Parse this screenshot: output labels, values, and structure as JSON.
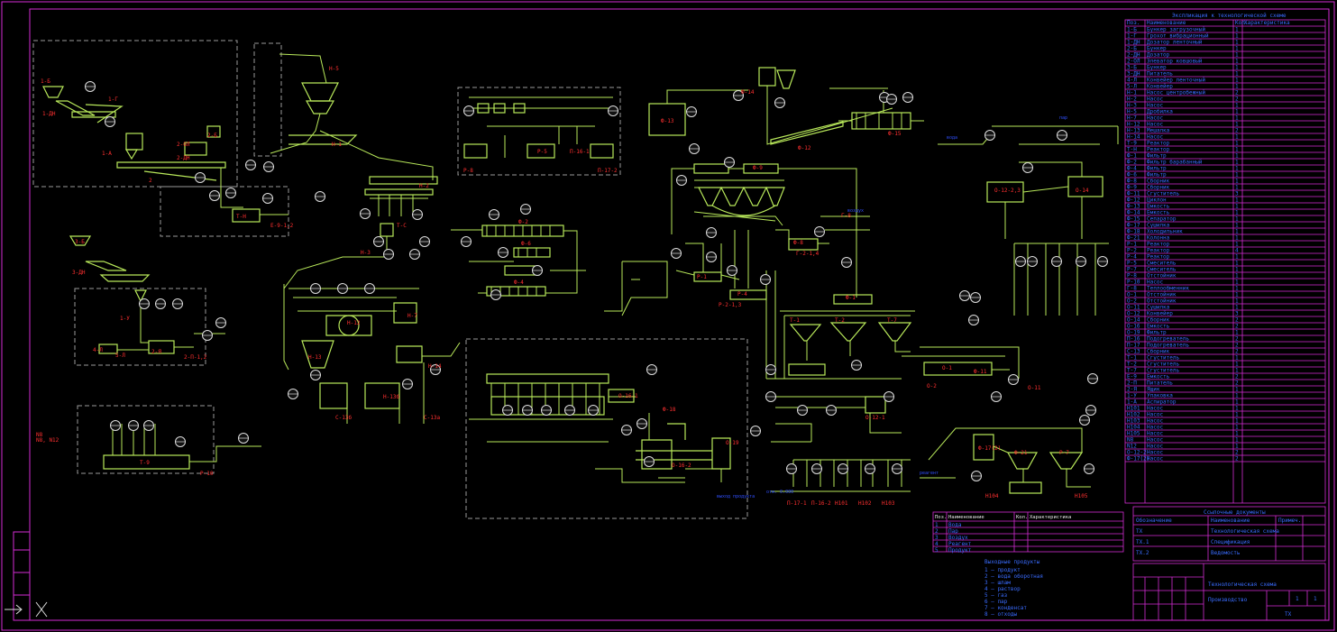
{
  "drawing": {
    "equipment_labels": [
      "1-Б",
      "1-ДН",
      "1-Г",
      "1-А",
      "2",
      "2-ДН",
      "2-ОЛ",
      "2-Б",
      "3-Б",
      "3-ДН",
      "1-У",
      "4-Л",
      "5-Л",
      "2-Я",
      "2-П-1,2",
      "Н-5",
      "Н-1",
      "Н-2",
      "Н-3",
      "Н-7",
      "Н-12",
      "Н-13",
      "Н-13б",
      "Н-14",
      "Т-Н",
      "Е-9-1,2",
      "Т-С",
      "С-13а",
      "С-13б",
      "Т-9",
      "Р-10",
      "Ф-2",
      "Ф-6",
      "Ф-4",
      "Ф-13",
      "Ф-14",
      "Ф-15",
      "Ф-12",
      "Ф-8",
      "Ф-9",
      "Ф-11",
      "Р-4",
      "Р-1",
      "Р-2-1,3",
      "Ф-1",
      "Г-8",
      "Г-2-1,4",
      "Т-1",
      "Т-2",
      "Т-7",
      "О-1",
      "О-2",
      "О-11",
      "О-12-1",
      "О-12-2,3",
      "О-14",
      "О-16-1",
      "О-16-2",
      "Ф-18",
      "О-19",
      "Ф-17(2)",
      "Ф-21",
      "Р-7",
      "Р-8",
      "Р-5",
      "П-16-1",
      "П-17-2",
      "П-17-1",
      "П-16-2",
      "Н101",
      "Н102",
      "Н103",
      "Н104",
      "Н105",
      "N8",
      "N8, N12"
    ],
    "flow_labels": [
      "отм. 0.000",
      "вода",
      "пар",
      "воздух",
      "реагент",
      "выход продукта"
    ],
    "spec_table": {
      "title": "Экспликация к технологической схеме",
      "headers": [
        "Поз.",
        "Наименование",
        "Кол.",
        "Характеристика"
      ],
      "rows": [
        [
          "1-Б",
          "Бункер загрузочный",
          "1",
          ""
        ],
        [
          "1-Г",
          "Грохот вибрационный",
          "1",
          ""
        ],
        [
          "1-ДН",
          "Дозатор ленточный",
          "1",
          ""
        ],
        [
          "2-Б",
          "Бункер",
          "1",
          ""
        ],
        [
          "2-ДН",
          "Дозатор",
          "1",
          ""
        ],
        [
          "2-ОЛ",
          "Элеватор ковшовый",
          "1",
          ""
        ],
        [
          "3-Б",
          "Бункер",
          "1",
          ""
        ],
        [
          "3-ДН",
          "Питатель",
          "1",
          ""
        ],
        [
          "4-Л",
          "Конвейер ленточный",
          "1",
          ""
        ],
        [
          "5-Л",
          "Конвейер",
          "1",
          ""
        ],
        [
          "Н-1",
          "Насос центробежный",
          "2",
          ""
        ],
        [
          "Н-2",
          "Насос",
          "2",
          ""
        ],
        [
          "Н-3",
          "Насос",
          "1",
          ""
        ],
        [
          "Н-5",
          "Дробилка",
          "1",
          ""
        ],
        [
          "Н-7",
          "Насос",
          "1",
          ""
        ],
        [
          "Н-12",
          "Насос",
          "1",
          ""
        ],
        [
          "Н-13",
          "Мешалка",
          "2",
          ""
        ],
        [
          "Н-14",
          "Насос",
          "1",
          ""
        ],
        [
          "Т-9",
          "Реактор",
          "1",
          ""
        ],
        [
          "Т-Н",
          "Реактор",
          "1",
          ""
        ],
        [
          "Ф-1",
          "Фильтр",
          "1",
          ""
        ],
        [
          "Ф-2",
          "Фильтр барабанный",
          "1",
          ""
        ],
        [
          "Ф-4",
          "Фильтр",
          "1",
          ""
        ],
        [
          "Ф-6",
          "Фильтр",
          "1",
          ""
        ],
        [
          "Ф-8",
          "Сборник",
          "1",
          ""
        ],
        [
          "Ф-9",
          "Сборник",
          "1",
          ""
        ],
        [
          "Ф-11",
          "Сгуститель",
          "3",
          ""
        ],
        [
          "Ф-12",
          "Циклон",
          "1",
          ""
        ],
        [
          "Ф-13",
          "Емкость",
          "1",
          ""
        ],
        [
          "Ф-14",
          "Емкость",
          "1",
          ""
        ],
        [
          "Ф-15",
          "Сепаратор",
          "1",
          ""
        ],
        [
          "Ф-17",
          "Сушилка",
          "1",
          ""
        ],
        [
          "Ф-18",
          "Холодильник",
          "1",
          ""
        ],
        [
          "Ф-21",
          "Колонна",
          "1",
          ""
        ],
        [
          "Р-1",
          "Реактор",
          "1",
          ""
        ],
        [
          "Р-2",
          "Реактор",
          "4",
          ""
        ],
        [
          "Р-4",
          "Реактор",
          "1",
          ""
        ],
        [
          "Р-5",
          "Смеситель",
          "1",
          ""
        ],
        [
          "Р-7",
          "Смеситель",
          "1",
          ""
        ],
        [
          "Р-8",
          "Отстойник",
          "1",
          ""
        ],
        [
          "Р-10",
          "Насос",
          "1",
          ""
        ],
        [
          "Г-8",
          "Теплообменник",
          "1",
          ""
        ],
        [
          "О-1",
          "Отстойник",
          "1",
          ""
        ],
        [
          "О-2",
          "Отстойник",
          "1",
          ""
        ],
        [
          "О-11",
          "Сушилка",
          "1",
          ""
        ],
        [
          "О-12",
          "Конвейер",
          "3",
          ""
        ],
        [
          "О-14",
          "Сборник",
          "2",
          ""
        ],
        [
          "О-16",
          "Емкость",
          "2",
          ""
        ],
        [
          "О-19",
          "Фильтр",
          "1",
          ""
        ],
        [
          "П-16",
          "Подогреватель",
          "2",
          ""
        ],
        [
          "П-17",
          "Подогреватель",
          "2",
          ""
        ],
        [
          "С-13",
          "Сборник",
          "2",
          ""
        ],
        [
          "Т-1",
          "Сгуститель",
          "1",
          ""
        ],
        [
          "Т-2",
          "Сгуститель",
          "1",
          ""
        ],
        [
          "Т-7",
          "Сгуститель",
          "1",
          ""
        ],
        [
          "Е-9",
          "Емкость",
          "2",
          ""
        ],
        [
          "2-П",
          "Питатель",
          "2",
          ""
        ],
        [
          "2-Я",
          "Ящик",
          "1",
          ""
        ],
        [
          "1-У",
          "Упаковка",
          "1",
          ""
        ],
        [
          "1-А",
          "Аспиратор",
          "1",
          ""
        ],
        [
          "Н101",
          "Насос",
          "1",
          ""
        ],
        [
          "Н102",
          "Насос",
          "1",
          ""
        ],
        [
          "Н103",
          "Насос",
          "1",
          ""
        ],
        [
          "Н104",
          "Насос",
          "1",
          ""
        ],
        [
          "Н105",
          "Насос",
          "1",
          ""
        ],
        [
          "N8",
          "Насос",
          "1",
          ""
        ],
        [
          "N12",
          "Насос",
          "1",
          ""
        ],
        [
          "О-12-2",
          "Насос",
          "2",
          ""
        ],
        [
          "Ф-17(2)",
          "Насос",
          "2",
          ""
        ]
      ]
    },
    "legend_table": {
      "headers": [
        "Поз.",
        "Наименование",
        "Кол.",
        "Характеристика"
      ],
      "rows": [
        [
          "1",
          "Вода",
          "",
          ""
        ],
        [
          "2",
          "Пар",
          "",
          ""
        ],
        [
          "3",
          "Воздух",
          "",
          ""
        ],
        [
          "4",
          "Реагент",
          "",
          ""
        ],
        [
          "5",
          "Продукт",
          "",
          ""
        ]
      ]
    },
    "notes": {
      "title": "Выходные продукты",
      "lines": [
        "1 — продукт",
        "2 — вода оборотная",
        "3 — шлам",
        "4 — раствор",
        "5 — газ",
        "6 — пар",
        "7 — конденсат",
        "8 — отходы"
      ]
    },
    "ref_table": {
      "title": "Ссылочные документы",
      "headers": [
        "Обозначение",
        "Наименование",
        "Примеч."
      ],
      "rows": [
        [
          "ТХ",
          "Технологическая схема",
          ""
        ],
        [
          "ТХ.1",
          "Спецификация",
          ""
        ],
        [
          "ТХ.2",
          "Ведомость",
          ""
        ]
      ]
    },
    "title_block": {
      "title": "Технологическая схема",
      "subtitle": "Производство",
      "sheet": "1",
      "sheets": "1",
      "stamp": "ТХ"
    }
  }
}
